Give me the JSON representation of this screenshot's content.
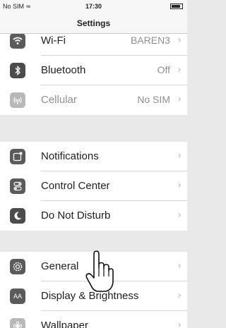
{
  "status_bar": {
    "carrier": "No SIM",
    "wifi_icon": "wifi-icon",
    "time": "17:30",
    "battery_icon": "battery-icon"
  },
  "nav": {
    "title": "Settings"
  },
  "groups": [
    {
      "rows": [
        {
          "label": "Wi-Fi",
          "value": "BAREN3",
          "icon": "wifi-icon"
        },
        {
          "label": "Bluetooth",
          "value": "Off",
          "icon": "bluetooth-icon"
        },
        {
          "label": "Cellular",
          "value": "No SIM",
          "icon": "cellular-icon"
        }
      ]
    },
    {
      "rows": [
        {
          "label": "Notifications",
          "icon": "notifications-icon"
        },
        {
          "label": "Control Center",
          "icon": "control-center-icon"
        },
        {
          "label": "Do Not Disturb",
          "icon": "moon-icon"
        }
      ]
    },
    {
      "rows": [
        {
          "label": "General",
          "icon": "gear-icon"
        },
        {
          "label": "Display & Brightness",
          "icon": "display-icon",
          "icon_text": "AA"
        },
        {
          "label": "Wallpaper",
          "icon": "wallpaper-icon"
        }
      ]
    }
  ],
  "overlay": {
    "pointer_icon": "hand-pointer-icon"
  }
}
